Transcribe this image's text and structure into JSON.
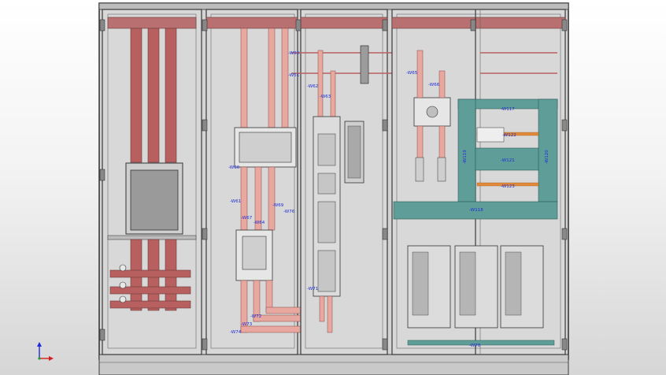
{
  "labels": {
    "w50": "-W50",
    "w51": "-W51",
    "w60": "-W60",
    "w61": "-W61",
    "w62": "-W62",
    "w63": "-W63",
    "w64": "-W64",
    "w65": "-W65",
    "w66": "-W66",
    "w67": "-W67",
    "w68": "-W68",
    "w69": "-W69",
    "w71": "-W71",
    "w72": "-W72",
    "w73": "-W73",
    "w74": "-W74",
    "w75": "-W75",
    "w76": "-W76",
    "w77": "-W77",
    "w78": "-W78",
    "w117": "-W117",
    "w118": "-W118",
    "w119": "-W119",
    "w120": "-W120",
    "w121": "-W121",
    "w122": "-W122",
    "w123": "-W123"
  },
  "colors": {
    "busbar": "#b86060",
    "busbar_light": "#e8a8a0",
    "teal_duct": "#5f9e98",
    "wire_blue": "#1d2bd6",
    "panel": "#d9d9d9",
    "frame": "#3a3a3a"
  },
  "icons": {
    "axis": "coordinate-axis-icon"
  }
}
